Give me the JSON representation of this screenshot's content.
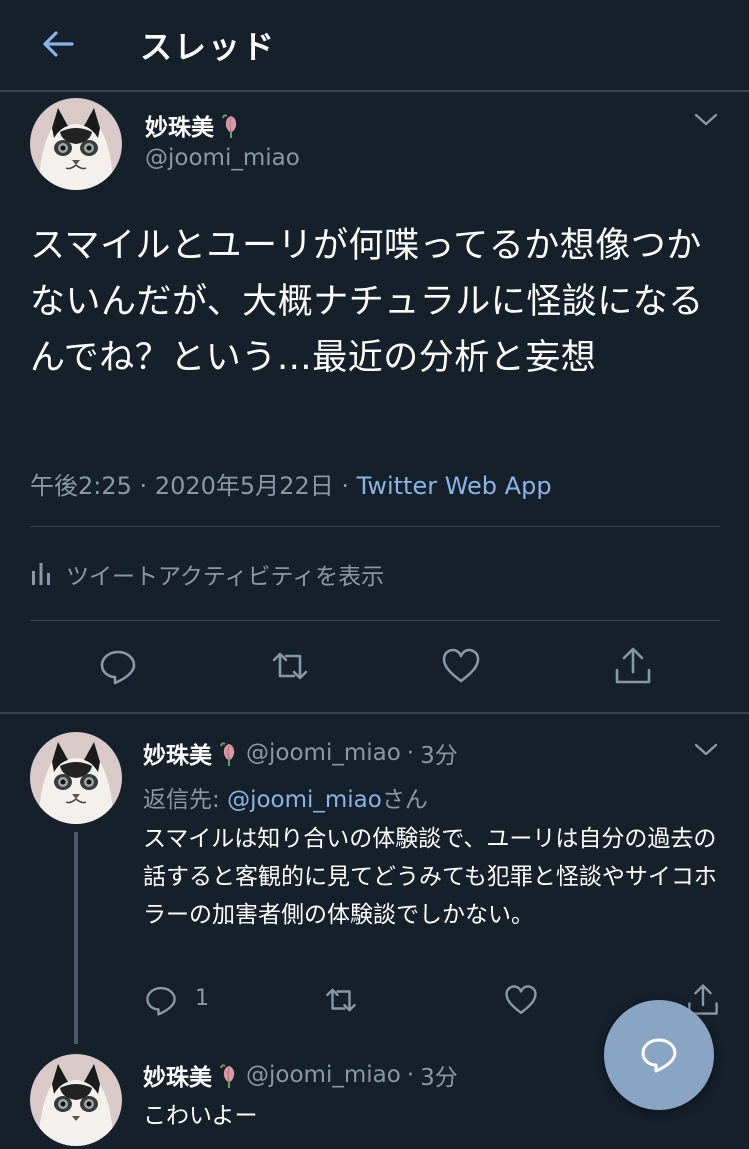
{
  "header": {
    "title": "スレッド",
    "back_icon": "arrow-left-icon"
  },
  "colors": {
    "background": "#15202b",
    "accent": "#8ab4e8",
    "muted": "#8899a6",
    "divider": "#38444d",
    "fab": "#8aa4c4"
  },
  "main_tweet": {
    "display_name": "妙珠美",
    "handle": "@joomi_miao",
    "text": "スマイルとユーリが何喋ってるか想像つかないんだが、大概ナチュラルに怪談になるんでね？という…最近の分析と妄想",
    "time": "午後2:25",
    "date": "2020年5月22日",
    "separator": "·",
    "source": "Twitter Web App",
    "activity_label": "ツイートアクティビティを表示"
  },
  "replies": [
    {
      "display_name": "妙珠美",
      "handle": "@joomi_miao",
      "separator": "·",
      "age": "3分",
      "reply_to_prefix": "返信先: ",
      "reply_to_handle": "@joomi_miao",
      "reply_to_suffix": "さん",
      "text": "スマイルは知り合いの体験談で、ユーリは自分の過去の話すると客観的に見てどうみても犯罪と怪談やサイコホラーの加害者側の体験談でしかない。",
      "reply_count": "1"
    },
    {
      "display_name": "妙珠美",
      "handle": "@joomi_miao",
      "separator": "·",
      "age": "3分",
      "text": "こわいよー"
    }
  ],
  "icons": {
    "reply": "reply-icon",
    "retweet": "retweet-icon",
    "like": "heart-icon",
    "share": "share-icon",
    "activity": "bar-chart-icon",
    "compose": "compose-reply-icon",
    "more": "chevron-down-icon"
  }
}
